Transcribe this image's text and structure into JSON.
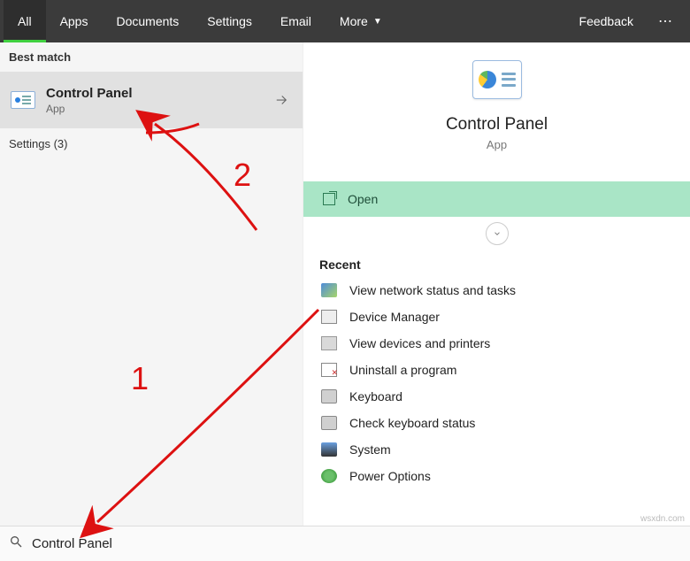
{
  "tabs": {
    "items": [
      "All",
      "Apps",
      "Documents",
      "Settings",
      "Email",
      "More"
    ],
    "active": 0,
    "feedback": "Feedback"
  },
  "left": {
    "best_match_header": "Best match",
    "best_result": {
      "title": "Control Panel",
      "subtitle": "App"
    },
    "settings_header": "Settings (3)"
  },
  "preview": {
    "title": "Control Panel",
    "subtitle": "App",
    "open_label": "Open",
    "recent_header": "Recent",
    "recent_items": [
      {
        "icon": "net",
        "label": "View network status and tasks"
      },
      {
        "icon": "dev",
        "label": "Device Manager"
      },
      {
        "icon": "prn",
        "label": "View devices and printers"
      },
      {
        "icon": "uni",
        "label": "Uninstall a program"
      },
      {
        "icon": "kb",
        "label": "Keyboard"
      },
      {
        "icon": "kb",
        "label": "Check keyboard status"
      },
      {
        "icon": "sys",
        "label": "System"
      },
      {
        "icon": "pwr",
        "label": "Power Options"
      }
    ]
  },
  "search": {
    "value": "Control Panel"
  },
  "annotations": {
    "step1": "1",
    "step2": "2"
  },
  "watermark": "wsxdn.com"
}
